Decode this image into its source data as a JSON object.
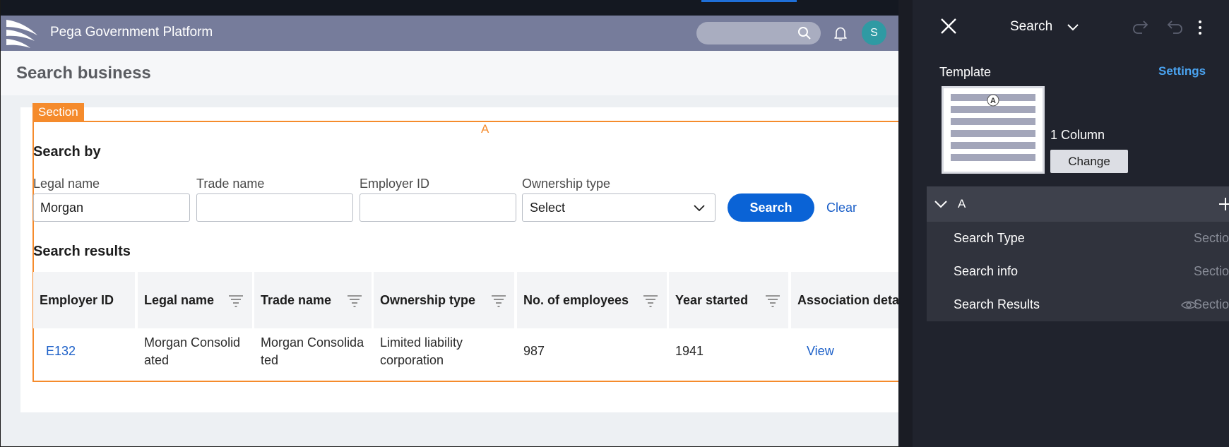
{
  "app": {
    "brand": "Pega Government Platform",
    "avatar_initial": "S",
    "page_title": "Search business"
  },
  "section": {
    "tag": "Section",
    "region_label": "A",
    "search_by_title": "Search by",
    "fields": {
      "legal_name": {
        "label": "Legal name",
        "value": "Morgan"
      },
      "trade_name": {
        "label": "Trade name",
        "value": ""
      },
      "employer_id": {
        "label": "Employer ID",
        "value": ""
      },
      "ownership_type": {
        "label": "Ownership type",
        "value": "Select"
      }
    },
    "search_button": "Search",
    "clear_link": "Clear",
    "results_title": "Search results",
    "columns": [
      "Employer ID",
      "Legal name",
      "Trade name",
      "Ownership type",
      "No. of employees",
      "Year started",
      "Association deta"
    ],
    "row": {
      "employer_id": "E132",
      "legal_name_1": "Morgan Consolid",
      "legal_name_2": "ated",
      "trade_name_1": "Morgan Consolida",
      "trade_name_2": "ted",
      "ownership_1": "Limited liability",
      "ownership_2": "corporation",
      "employees": "987",
      "year_started": "1941",
      "association": "View"
    }
  },
  "panel": {
    "title": "Search",
    "template_label": "Template",
    "settings_link": "Settings",
    "thumbnail_region": "A",
    "column_label": "1 Column",
    "change_button": "Change",
    "region_name": "A",
    "items": [
      {
        "name": "Search Type",
        "type": "Section"
      },
      {
        "name": "Search info",
        "type": "Section"
      },
      {
        "name": "Search Results",
        "type": "Section"
      }
    ]
  },
  "colors": {
    "header": "#767c9b",
    "accent_orange": "#f58b2c",
    "primary_blue": "#0a63d6",
    "link_blue": "#1b5fc8",
    "panel_bg": "#20232d"
  }
}
